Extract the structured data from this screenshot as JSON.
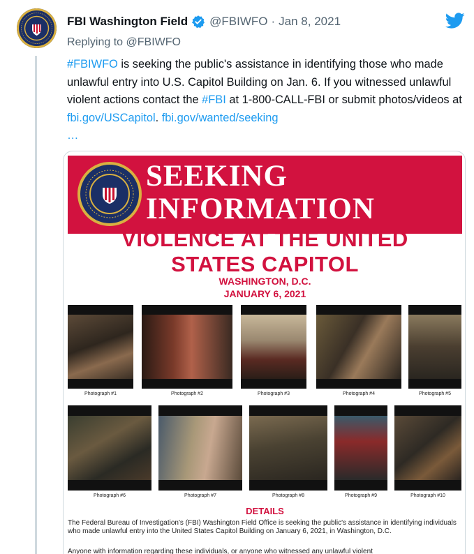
{
  "tweet": {
    "display_name": "FBI Washington Field",
    "handle": "@FBIWFO",
    "separator": "·",
    "date": "Jan 8, 2021",
    "reply_prefix": "Replying to",
    "reply_handle": "@FBIWFO",
    "text": {
      "hashtag1": "#FBIWFO",
      "part1": " is seeking the public's assistance in identifying those who made unlawful entry into U.S. Capitol Building on Jan. 6. If you witnessed unlawful violent actions contact the ",
      "hashtag2": "#FBI",
      "part2": " at 1-800-CALL-FBI or submit photos/videos at ",
      "link1": "fbi.gov/USCapitol",
      "part3": ". ",
      "link2": "fbi.gov/wanted/seeking",
      "ellipsis": "…"
    }
  },
  "poster": {
    "title_line1": "SEEKING",
    "title_line2": "INFORMATION",
    "headline_line1": "VIOLENCE AT THE UNITED",
    "headline_line2": "STATES CAPITOL",
    "location": "WASHINGTON, D.C.",
    "date": "JANUARY 6, 2021",
    "photos": [
      {
        "caption": "Photograph #1"
      },
      {
        "caption": "Photograph #2"
      },
      {
        "caption": "Photograph #3"
      },
      {
        "caption": "Photograph #4"
      },
      {
        "caption": "Photograph #5"
      },
      {
        "caption": "Photograph #6"
      },
      {
        "caption": "Photograph #7"
      },
      {
        "caption": "Photograph #8"
      },
      {
        "caption": "Photograph #9"
      },
      {
        "caption": "Photograph #10"
      }
    ],
    "details_heading": "DETAILS",
    "details_text": "The Federal Bureau of Investigation's (FBI) Washington Field Office is seeking the public's assistance in identifying individuals who made unlawful entry into the United States Capitol Building on January 6, 2021, in Washington, D.C.",
    "details_text2": "Anyone with information regarding these individuals, or anyone who witnessed any unlawful violent"
  },
  "colors": {
    "link": "#1d9bf0",
    "poster_red": "#d2123f",
    "seal_blue": "#1b2f66",
    "seal_gold": "#d9b040"
  },
  "icons": [
    "verified-badge-icon",
    "twitter-bird-icon",
    "fbi-seal-icon"
  ]
}
